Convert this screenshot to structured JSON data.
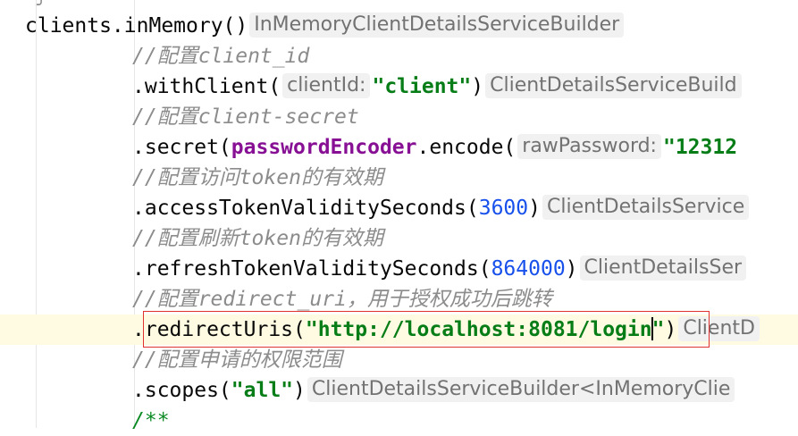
{
  "lines": [
    {
      "tokens": [
        {
          "text": "clients.inMemory()",
          "cls": ""
        }
      ],
      "hint": "InMemoryClientDetailsServiceBuilder"
    },
    {
      "tokens": [
        {
          "text": "//配置client_id",
          "cls": "comment"
        }
      ]
    },
    {
      "tokens": [
        {
          "text": ".withClient(",
          "cls": ""
        },
        {
          "hint": "clientId:"
        },
        {
          "text": "\"client\"",
          "cls": "str"
        },
        {
          "text": ")",
          "cls": ""
        }
      ],
      "hint": "ClientDetailsServiceBuild"
    },
    {
      "tokens": [
        {
          "text": "//配置client-secret",
          "cls": "comment"
        }
      ]
    },
    {
      "tokens": [
        {
          "text": ".secret(",
          "cls": ""
        },
        {
          "text": "passwordEncoder",
          "cls": "field"
        },
        {
          "text": ".encode(",
          "cls": ""
        },
        {
          "hint": "rawPassword:"
        },
        {
          "text": "\"12312",
          "cls": "str"
        }
      ]
    },
    {
      "tokens": [
        {
          "text": "//配置访问token的有效期",
          "cls": "comment"
        }
      ]
    },
    {
      "tokens": [
        {
          "text": ".accessTokenValiditySeconds(",
          "cls": ""
        },
        {
          "text": "3600",
          "cls": "num"
        },
        {
          "text": ")",
          "cls": ""
        }
      ],
      "hint": "ClientDetailsService"
    },
    {
      "tokens": [
        {
          "text": "//配置刷新token的有效期",
          "cls": "comment"
        }
      ]
    },
    {
      "tokens": [
        {
          "text": ".refreshTokenValiditySeconds(",
          "cls": ""
        },
        {
          "text": "864000",
          "cls": "num"
        },
        {
          "text": ")",
          "cls": ""
        }
      ],
      "hint": "ClientDetailsSer"
    },
    {
      "tokens": [
        {
          "text": "//配置redirect_uri，用于授权成功后跳转",
          "cls": "comment"
        }
      ]
    },
    {
      "tokens": [
        {
          "text": ".redirectUris(",
          "cls": ""
        },
        {
          "text": "\"http://localhost:8081/login",
          "cls": "str"
        },
        {
          "caret": true
        },
        {
          "text": "\"",
          "cls": "str"
        },
        {
          "text": ")",
          "cls": ""
        }
      ],
      "hint": "ClientD",
      "current": true
    },
    {
      "tokens": [
        {
          "text": "//配置申请的权限范围",
          "cls": "comment"
        }
      ]
    },
    {
      "tokens": [
        {
          "text": ".scopes(",
          "cls": ""
        },
        {
          "text": "\"all\"",
          "cls": "str"
        },
        {
          "text": ")",
          "cls": ""
        }
      ],
      "hint": "ClientDetailsServiceBuilder<InMemoryClie"
    },
    {
      "tokens": [
        {
          "text": "/**",
          "cls": "doc"
        }
      ]
    }
  ]
}
